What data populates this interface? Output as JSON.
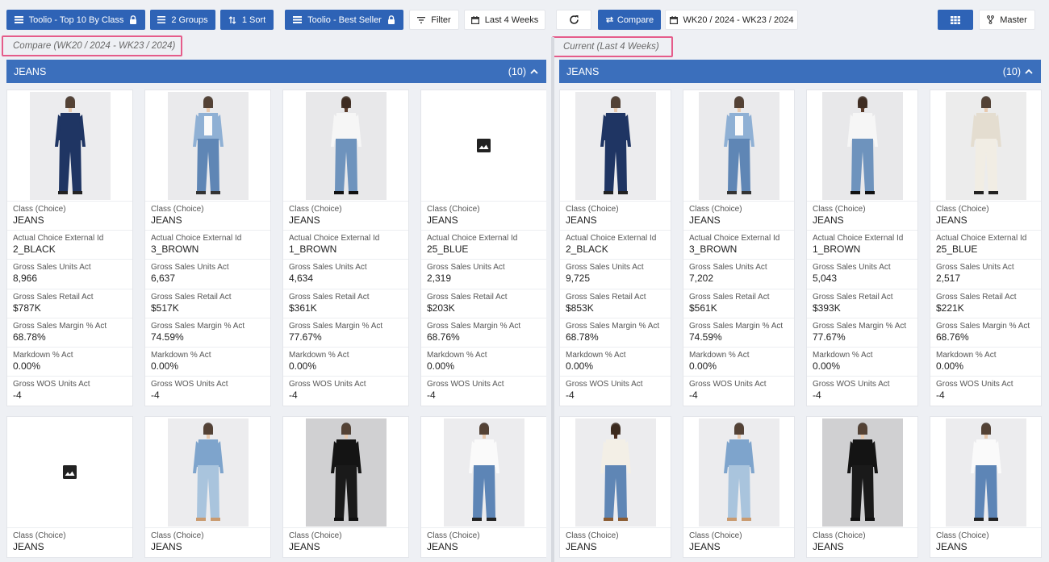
{
  "toolbar": {
    "view_name": "Toolio - Top 10 By Class",
    "groups": "2 Groups",
    "sort": "1 Sort",
    "assortment": "Toolio - Best Seller",
    "filter": "Filter",
    "range": "Last 4 Weeks",
    "compare": "Compare",
    "compare_range": "WK20 / 2024 - WK23 / 2024",
    "master": "Master"
  },
  "compare_panel": {
    "label": "Compare (WK20 / 2024 - WK23 / 2024)",
    "group_title": "JEANS",
    "group_count": "(10)"
  },
  "current_panel": {
    "label": "Current (Last 4 Weeks)",
    "group_title": "JEANS",
    "group_count": "(10)"
  },
  "field_labels": {
    "class": "Class (Choice)",
    "ext_id": "Actual Choice External Id",
    "units": "Gross Sales Units Act",
    "retail": "Gross Sales Retail Act",
    "margin": "Gross Sales Margin % Act",
    "markdown": "Markdown % Act",
    "wos": "Gross WOS Units Act"
  },
  "compare_cards": [
    {
      "class": "JEANS",
      "ext_id": "2_BLACK",
      "units": "8,966",
      "retail": "$787K",
      "margin": "68.78%",
      "markdown": "0.00%",
      "wos": "-4",
      "image": "photo-navy-jumpsuit"
    },
    {
      "class": "JEANS",
      "ext_id": "3_BROWN",
      "units": "6,637",
      "retail": "$517K",
      "margin": "74.59%",
      "markdown": "0.00%",
      "wos": "-4",
      "image": "photo-denim-shirt"
    },
    {
      "class": "JEANS",
      "ext_id": "1_BROWN",
      "units": "4,634",
      "retail": "$361K",
      "margin": "77.67%",
      "markdown": "0.00%",
      "wos": "-4",
      "image": "photo-white-tee-jeans"
    },
    {
      "class": "JEANS",
      "ext_id": "25_BLUE",
      "units": "2,319",
      "retail": "$203K",
      "margin": "68.76%",
      "markdown": "0.00%",
      "wos": "-4",
      "image": "image-placeholder"
    }
  ],
  "compare_cards_row2": [
    {
      "class": "JEANS",
      "image": "image-placeholder"
    },
    {
      "class": "JEANS",
      "image": "photo-denim-corset"
    },
    {
      "class": "JEANS",
      "image": "photo-black-cargo"
    },
    {
      "class": "JEANS",
      "image": "photo-crop-tee-jeans"
    }
  ],
  "current_cards": [
    {
      "class": "JEANS",
      "ext_id": "2_BLACK",
      "units": "9,725",
      "retail": "$853K",
      "margin": "68.78%",
      "markdown": "0.00%",
      "wos": "-4",
      "image": "photo-navy-jumpsuit"
    },
    {
      "class": "JEANS",
      "ext_id": "3_BROWN",
      "units": "7,202",
      "retail": "$561K",
      "margin": "74.59%",
      "markdown": "0.00%",
      "wos": "-4",
      "image": "photo-denim-shirt"
    },
    {
      "class": "JEANS",
      "ext_id": "1_BROWN",
      "units": "5,043",
      "retail": "$393K",
      "margin": "77.67%",
      "markdown": "0.00%",
      "wos": "-4",
      "image": "photo-white-tee-jeans"
    },
    {
      "class": "JEANS",
      "ext_id": "25_BLUE",
      "units": "2,517",
      "retail": "$221K",
      "margin": "68.76%",
      "markdown": "0.00%",
      "wos": "-4",
      "image": "photo-cream-jacket"
    }
  ],
  "current_cards_row2": [
    {
      "class": "JEANS",
      "image": "photo-cream-sweater"
    },
    {
      "class": "JEANS",
      "image": "photo-denim-corset"
    },
    {
      "class": "JEANS",
      "image": "photo-black-cargo"
    },
    {
      "class": "JEANS",
      "image": "photo-crop-tee-jeans"
    }
  ],
  "colors": {
    "primary": "#2e63b6",
    "header": "#3b6fbc",
    "highlight": "#e55c8a",
    "background": "#eef0f4"
  }
}
